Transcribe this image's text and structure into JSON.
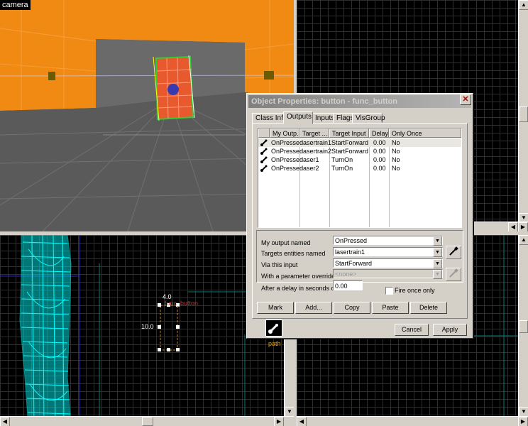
{
  "viewports": {
    "camera_label": "camera",
    "side_labels": {
      "width_value": "4.0",
      "height_value": "10.0",
      "entity_name": "func_button",
      "path_label": "path"
    }
  },
  "dialog": {
    "title": "Object Properties: button - func_button",
    "close_glyph": "✕",
    "tabs": [
      "Class Info",
      "Outputs",
      "Inputs",
      "Flags",
      "VisGroup"
    ],
    "active_tab": "Outputs",
    "columns": [
      "My Outp...",
      "Target ...",
      "Target Input",
      "Delay",
      "Only Once"
    ],
    "rows": [
      {
        "output": "OnPressed",
        "target": "lasertrain1",
        "input": "StartForward",
        "delay": "0.00",
        "once": "No"
      },
      {
        "output": "OnPressed",
        "target": "lasertrain2",
        "input": "StartForward",
        "delay": "0.00",
        "once": "No"
      },
      {
        "output": "OnPressed",
        "target": "laser1",
        "input": "TurnOn",
        "delay": "0.00",
        "once": "No"
      },
      {
        "output": "OnPressed",
        "target": "laser2",
        "input": "TurnOn",
        "delay": "0.00",
        "once": "No"
      }
    ],
    "fields": {
      "output_label": "My output named",
      "output_value": "OnPressed",
      "targets_label": "Targets entities named",
      "targets_value": "lasertrain1",
      "input_label": "Via this input",
      "input_value": "StartForward",
      "param_label": "With a parameter override of",
      "param_value": "<none>",
      "delay_label": "After a delay in seconds of",
      "delay_value": "0.00",
      "fire_once_label": "Fire once only"
    },
    "buttons": {
      "mark": "Mark",
      "add": "Add...",
      "copy": "Copy",
      "paste": "Paste",
      "delete": "Delete",
      "cancel": "Cancel",
      "apply": "Apply"
    },
    "colors": {
      "row_icon": "#000000",
      "selection": "#e9e7e2"
    }
  }
}
